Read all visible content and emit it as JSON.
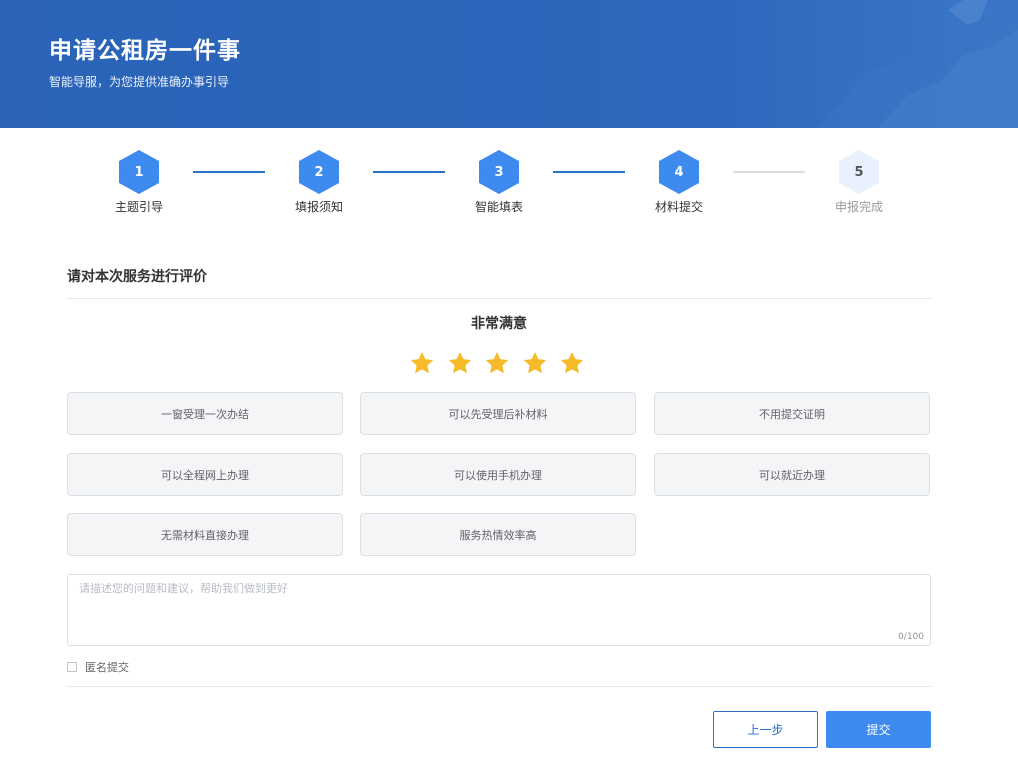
{
  "header": {
    "title": "申请公租房一件事",
    "subtitle": "智能导服，为您提供准确办事引导"
  },
  "steps": [
    {
      "number": "1",
      "label": "主题引导",
      "status": "done"
    },
    {
      "number": "2",
      "label": "填报须知",
      "status": "done"
    },
    {
      "number": "3",
      "label": "智能填表",
      "status": "done"
    },
    {
      "number": "4",
      "label": "材料提交",
      "status": "current"
    },
    {
      "number": "5",
      "label": "申报完成",
      "status": "pending"
    }
  ],
  "evaluation": {
    "section_title": "请对本次服务进行评价",
    "rating_text": "非常满意",
    "rating": 5,
    "max_rating": 5,
    "tags": [
      "一窗受理一次办结",
      "可以先受理后补材料",
      "不用提交证明",
      "可以全程网上办理",
      "可以使用手机办理",
      "可以就近办理",
      "无需材料直接办理",
      "服务热情效率高"
    ],
    "comment": {
      "placeholder": "请描述您的问题和建议，帮助我们做到更好",
      "value": "",
      "counter": "0/100"
    },
    "anonymous_label": "匿名提交"
  },
  "actions": {
    "prev_label": "上一步",
    "submit_label": "提交"
  },
  "colors": {
    "banner": "#2a63b8",
    "accent": "#3d8bef",
    "star": "#f7ba2a"
  }
}
